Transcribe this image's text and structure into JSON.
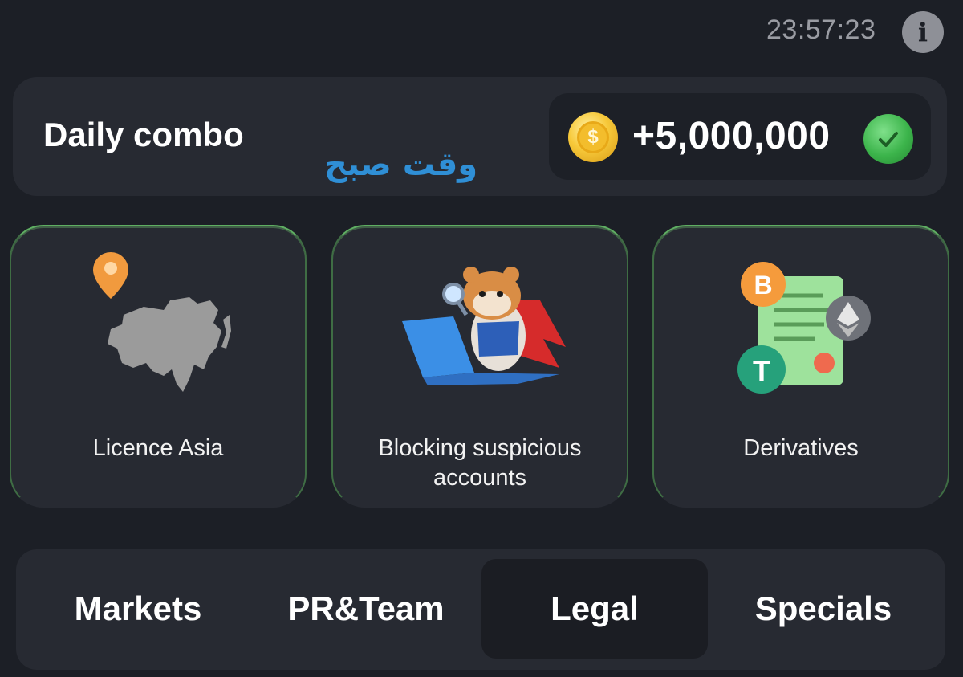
{
  "status": {
    "time": "23:57:23",
    "info_icon": "info-icon",
    "info_glyph": "i"
  },
  "combo": {
    "title": "Daily combo",
    "overlay_text": "وقت صبح",
    "coin_icon": "coin-icon",
    "coin_glyph": "$",
    "reward": "+5,000,000",
    "check_icon": "check-circle-icon"
  },
  "cards": [
    {
      "label": "Licence Asia",
      "icon": "asia-map-icon"
    },
    {
      "label": "Blocking suspicious accounts",
      "icon": "hamster-laptop-icon"
    },
    {
      "label": "Derivatives",
      "icon": "crypto-document-icon"
    }
  ],
  "tabs": [
    {
      "label": "Markets",
      "active": false
    },
    {
      "label": "PR&Team",
      "active": false
    },
    {
      "label": "Legal",
      "active": true
    },
    {
      "label": "Specials",
      "active": false
    }
  ],
  "colors": {
    "background": "#1c1f26",
    "panel": "#272a32",
    "accent_green": "#5fae62",
    "arabic_text": "#2f8fd6"
  }
}
